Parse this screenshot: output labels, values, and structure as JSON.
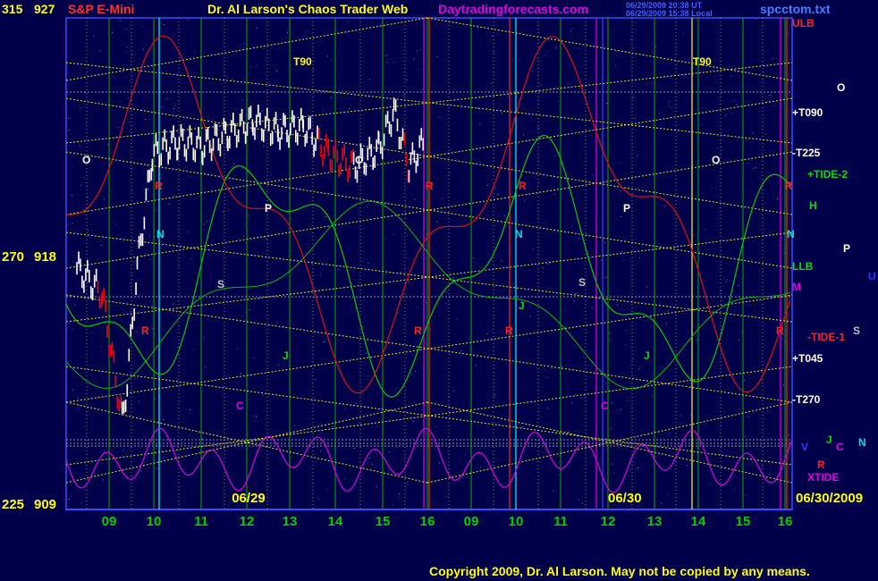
{
  "header": {
    "title_left": "S&P E-Mini",
    "title_center": "Dr. Al Larson's Chaos Trader Web",
    "website": "Daytradingforecasts.com",
    "timestamp_1": "06/29/2009 20:38 UT",
    "timestamp_2": "06/29/2009 15:38 Local",
    "filename": "spcctom.txt"
  },
  "price_axis": {
    "top": {
      "left": "315",
      "right": "927"
    },
    "mid": {
      "left": "270",
      "right": "918"
    },
    "bottom": {
      "left": "225",
      "right": "909"
    }
  },
  "footer": {
    "copyright": "Copyright 2009, Dr. Al Larson. May not be copied by any means."
  },
  "colors": {
    "background": "#00004a",
    "grid_yellow": "#ffff00",
    "price_bar": "#ffffff",
    "price_bar_down": "#ff0000",
    "flow_green": "#00d000",
    "flow_red": "#e01010",
    "xtide": "#e000e0"
  },
  "chart_data": {
    "type": "line",
    "title": "S&P E-Mini",
    "x_tick_labels": [
      "09",
      "10",
      "11",
      "12",
      "13",
      "14",
      "15",
      "16",
      "09",
      "10",
      "11",
      "12",
      "13",
      "14",
      "15",
      "16"
    ],
    "date_labels": [
      "06/29",
      "06/30",
      "06/30/2009"
    ],
    "price_range": [
      909,
      927
    ],
    "price_ticks": [
      927,
      918,
      909
    ],
    "price_bars_0629": [
      {
        "hour": 9.0,
        "price": 918.0
      },
      {
        "hour": 9.5,
        "price": 917.0
      },
      {
        "hour": 9.7,
        "price": 914.5
      },
      {
        "hour": 9.9,
        "price": 912.0
      },
      {
        "hour": 10.0,
        "price": 913.5
      },
      {
        "hour": 10.2,
        "price": 918.0
      },
      {
        "hour": 10.5,
        "price": 922.5
      },
      {
        "hour": 11.0,
        "price": 923.0
      },
      {
        "hour": 11.5,
        "price": 922.8
      },
      {
        "hour": 12.0,
        "price": 923.3
      },
      {
        "hour": 12.5,
        "price": 923.8
      },
      {
        "hour": 13.0,
        "price": 923.4
      },
      {
        "hour": 13.5,
        "price": 923.6
      },
      {
        "hour": 14.0,
        "price": 922.5
      },
      {
        "hour": 14.5,
        "price": 922.0
      },
      {
        "hour": 15.0,
        "price": 922.7
      },
      {
        "hour": 15.3,
        "price": 924.2
      },
      {
        "hour": 15.6,
        "price": 922.0
      },
      {
        "hour": 15.9,
        "price": 923.0
      }
    ],
    "right_labels": [
      {
        "text": "ULB",
        "color": "#ff2020"
      },
      {
        "text": "+T090",
        "color": "#ffffff"
      },
      {
        "text": "-T225",
        "color": "#ffffff"
      },
      {
        "text": "+TIDE-2",
        "color": "#00e000"
      },
      {
        "text": "H",
        "color": "#00e000"
      },
      {
        "text": "LLB",
        "color": "#00e000"
      },
      {
        "text": "M",
        "color": "#e000e0"
      },
      {
        "text": "-TIDE-1",
        "color": "#ff2020"
      },
      {
        "text": "+T045",
        "color": "#ffffff"
      },
      {
        "text": "-T270",
        "color": "#ffffff"
      },
      {
        "text": "XTIDE",
        "color": "#e000e0"
      }
    ],
    "planet_labels": [
      {
        "text": "O",
        "color": "#ffffff"
      },
      {
        "text": "P",
        "color": "#ffffff"
      },
      {
        "text": "U",
        "color": "#2040ff"
      },
      {
        "text": "S",
        "color": "#c0c0c0"
      },
      {
        "text": "V",
        "color": "#2040ff"
      },
      {
        "text": "J",
        "color": "#00e000"
      },
      {
        "text": "C",
        "color": "#e000e0"
      },
      {
        "text": "N",
        "color": "#00e0e0"
      },
      {
        "text": "R",
        "color": "#ff2020"
      },
      {
        "text": "T90",
        "color": "#ffff00"
      }
    ],
    "grid": true
  }
}
